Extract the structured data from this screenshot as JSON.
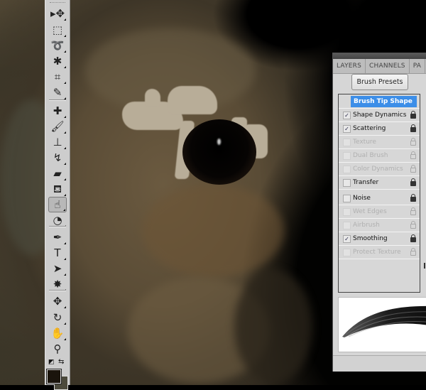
{
  "app": "Photoshop",
  "canvas": {
    "subject": "close-up painting of a rabbit's eye"
  },
  "toolbox": {
    "tools": [
      {
        "name": "move-tool",
        "glyph": "▸✥"
      },
      {
        "name": "marquee-tool",
        "glyph": "⬚"
      },
      {
        "name": "lasso-tool",
        "glyph": "➰"
      },
      {
        "name": "quick-selection-tool",
        "glyph": "✱"
      },
      {
        "name": "crop-tool",
        "glyph": "⌗"
      },
      {
        "name": "eyedropper-tool",
        "glyph": "✎"
      },
      {
        "name": "healing-brush-tool",
        "glyph": "✚"
      },
      {
        "name": "brush-tool",
        "glyph": "🖌"
      },
      {
        "name": "clone-stamp-tool",
        "glyph": "⊥"
      },
      {
        "name": "history-brush-tool",
        "glyph": "↯"
      },
      {
        "name": "eraser-tool",
        "glyph": "▰"
      },
      {
        "name": "paint-bucket-tool",
        "glyph": "⛾"
      },
      {
        "name": "smudge-tool",
        "glyph": "☝"
      },
      {
        "name": "dodge-tool",
        "glyph": "◔"
      },
      {
        "name": "pen-tool",
        "glyph": "✒"
      },
      {
        "name": "type-tool",
        "glyph": "T"
      },
      {
        "name": "path-selection-tool",
        "glyph": "➤"
      },
      {
        "name": "custom-shape-tool",
        "glyph": "✸"
      },
      {
        "name": "3d-rotate-tool",
        "glyph": "✥"
      },
      {
        "name": "3d-orbit-tool",
        "glyph": "↻"
      },
      {
        "name": "hand-tool",
        "glyph": "✋"
      },
      {
        "name": "zoom-tool",
        "glyph": "⚲"
      }
    ],
    "active_tool": "smudge-tool",
    "swap_glyph": "⇆",
    "default_colors_glyph": "◩",
    "foreground_color": "#1a140c",
    "background_color": "#4c4a3c"
  },
  "panel": {
    "tabs": [
      "LAYERS",
      "CHANNELS",
      "PA"
    ],
    "brush_presets_label": "Brush Presets",
    "header": "Brush Tip Shape",
    "options": [
      {
        "label": "Shape Dynamics",
        "checked": true,
        "enabled": true,
        "locked": true
      },
      {
        "label": "Scattering",
        "checked": true,
        "enabled": true,
        "locked": true
      },
      {
        "label": "Texture",
        "checked": false,
        "enabled": false,
        "locked": false
      },
      {
        "label": "Dual Brush",
        "checked": false,
        "enabled": false,
        "locked": false
      },
      {
        "label": "Color Dynamics",
        "checked": false,
        "enabled": false,
        "locked": false
      },
      {
        "label": "Transfer",
        "checked": false,
        "enabled": true,
        "locked": true
      },
      {
        "label": "Noise",
        "checked": false,
        "enabled": true,
        "locked": true
      },
      {
        "label": "Wet Edges",
        "checked": false,
        "enabled": false,
        "locked": false
      },
      {
        "label": "Airbrush",
        "checked": false,
        "enabled": false,
        "locked": false
      },
      {
        "label": "Smoothing",
        "checked": true,
        "enabled": true,
        "locked": true
      },
      {
        "label": "Protect Texture",
        "checked": false,
        "enabled": false,
        "locked": false
      }
    ],
    "check_glyph": "✓",
    "highlight_color": "#3c8ee8"
  }
}
